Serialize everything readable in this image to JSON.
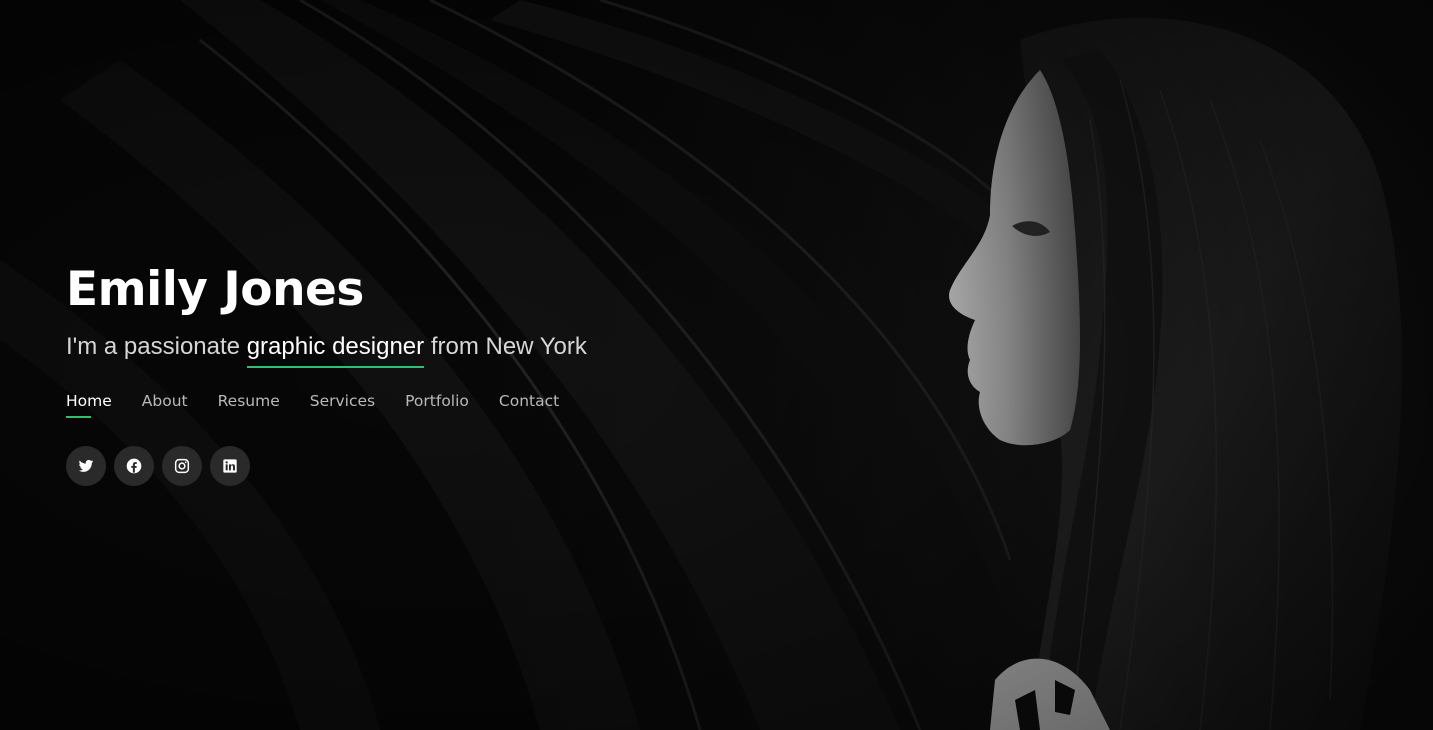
{
  "hero": {
    "name": "Emily Jones",
    "tagline_prefix": "I'm a passionate",
    "tagline_typed": "graphic designer",
    "tagline_suffix": "from New York"
  },
  "nav": {
    "items": [
      {
        "label": "Home",
        "active": true
      },
      {
        "label": "About",
        "active": false
      },
      {
        "label": "Resume",
        "active": false
      },
      {
        "label": "Services",
        "active": false
      },
      {
        "label": "Portfolio",
        "active": false
      },
      {
        "label": "Contact",
        "active": false
      }
    ]
  },
  "social": {
    "icons": [
      "twitter-icon",
      "facebook-icon",
      "instagram-icon",
      "linkedin-icon"
    ]
  },
  "colors": {
    "accent": "#2fbf71",
    "background": "#0b0b0b",
    "text": "#ffffff",
    "muted_text": "#b9b9b9",
    "social_button_bg": "#2a2a2a"
  }
}
